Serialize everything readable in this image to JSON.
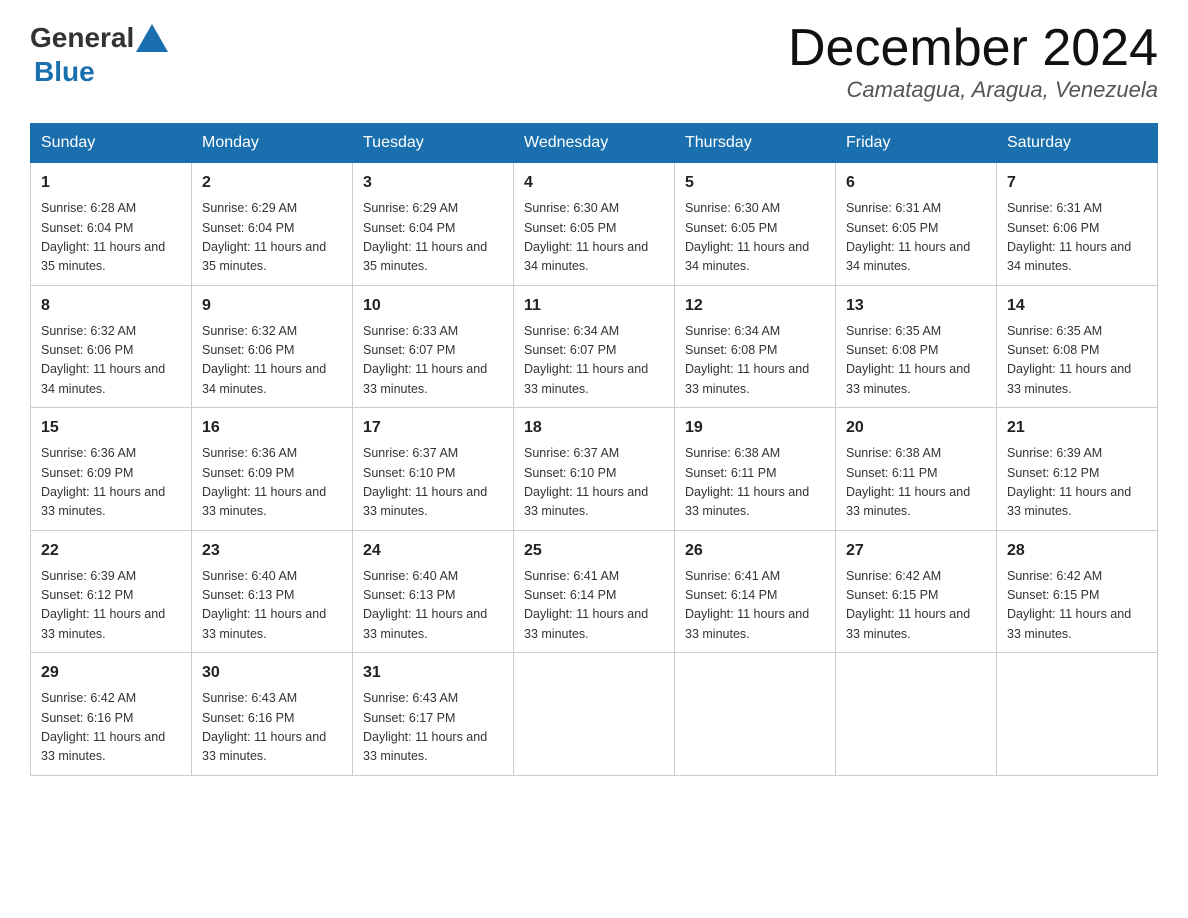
{
  "header": {
    "logo_general": "General",
    "logo_blue": "Blue",
    "month_title": "December 2024",
    "location": "Camatagua, Aragua, Venezuela"
  },
  "days_of_week": [
    "Sunday",
    "Monday",
    "Tuesday",
    "Wednesday",
    "Thursday",
    "Friday",
    "Saturday"
  ],
  "weeks": [
    [
      {
        "day": "1",
        "sunrise": "6:28 AM",
        "sunset": "6:04 PM",
        "daylight": "11 hours and 35 minutes."
      },
      {
        "day": "2",
        "sunrise": "6:29 AM",
        "sunset": "6:04 PM",
        "daylight": "11 hours and 35 minutes."
      },
      {
        "day": "3",
        "sunrise": "6:29 AM",
        "sunset": "6:04 PM",
        "daylight": "11 hours and 35 minutes."
      },
      {
        "day": "4",
        "sunrise": "6:30 AM",
        "sunset": "6:05 PM",
        "daylight": "11 hours and 34 minutes."
      },
      {
        "day": "5",
        "sunrise": "6:30 AM",
        "sunset": "6:05 PM",
        "daylight": "11 hours and 34 minutes."
      },
      {
        "day": "6",
        "sunrise": "6:31 AM",
        "sunset": "6:05 PM",
        "daylight": "11 hours and 34 minutes."
      },
      {
        "day": "7",
        "sunrise": "6:31 AM",
        "sunset": "6:06 PM",
        "daylight": "11 hours and 34 minutes."
      }
    ],
    [
      {
        "day": "8",
        "sunrise": "6:32 AM",
        "sunset": "6:06 PM",
        "daylight": "11 hours and 34 minutes."
      },
      {
        "day": "9",
        "sunrise": "6:32 AM",
        "sunset": "6:06 PM",
        "daylight": "11 hours and 34 minutes."
      },
      {
        "day": "10",
        "sunrise": "6:33 AM",
        "sunset": "6:07 PM",
        "daylight": "11 hours and 33 minutes."
      },
      {
        "day": "11",
        "sunrise": "6:34 AM",
        "sunset": "6:07 PM",
        "daylight": "11 hours and 33 minutes."
      },
      {
        "day": "12",
        "sunrise": "6:34 AM",
        "sunset": "6:08 PM",
        "daylight": "11 hours and 33 minutes."
      },
      {
        "day": "13",
        "sunrise": "6:35 AM",
        "sunset": "6:08 PM",
        "daylight": "11 hours and 33 minutes."
      },
      {
        "day": "14",
        "sunrise": "6:35 AM",
        "sunset": "6:08 PM",
        "daylight": "11 hours and 33 minutes."
      }
    ],
    [
      {
        "day": "15",
        "sunrise": "6:36 AM",
        "sunset": "6:09 PM",
        "daylight": "11 hours and 33 minutes."
      },
      {
        "day": "16",
        "sunrise": "6:36 AM",
        "sunset": "6:09 PM",
        "daylight": "11 hours and 33 minutes."
      },
      {
        "day": "17",
        "sunrise": "6:37 AM",
        "sunset": "6:10 PM",
        "daylight": "11 hours and 33 minutes."
      },
      {
        "day": "18",
        "sunrise": "6:37 AM",
        "sunset": "6:10 PM",
        "daylight": "11 hours and 33 minutes."
      },
      {
        "day": "19",
        "sunrise": "6:38 AM",
        "sunset": "6:11 PM",
        "daylight": "11 hours and 33 minutes."
      },
      {
        "day": "20",
        "sunrise": "6:38 AM",
        "sunset": "6:11 PM",
        "daylight": "11 hours and 33 minutes."
      },
      {
        "day": "21",
        "sunrise": "6:39 AM",
        "sunset": "6:12 PM",
        "daylight": "11 hours and 33 minutes."
      }
    ],
    [
      {
        "day": "22",
        "sunrise": "6:39 AM",
        "sunset": "6:12 PM",
        "daylight": "11 hours and 33 minutes."
      },
      {
        "day": "23",
        "sunrise": "6:40 AM",
        "sunset": "6:13 PM",
        "daylight": "11 hours and 33 minutes."
      },
      {
        "day": "24",
        "sunrise": "6:40 AM",
        "sunset": "6:13 PM",
        "daylight": "11 hours and 33 minutes."
      },
      {
        "day": "25",
        "sunrise": "6:41 AM",
        "sunset": "6:14 PM",
        "daylight": "11 hours and 33 minutes."
      },
      {
        "day": "26",
        "sunrise": "6:41 AM",
        "sunset": "6:14 PM",
        "daylight": "11 hours and 33 minutes."
      },
      {
        "day": "27",
        "sunrise": "6:42 AM",
        "sunset": "6:15 PM",
        "daylight": "11 hours and 33 minutes."
      },
      {
        "day": "28",
        "sunrise": "6:42 AM",
        "sunset": "6:15 PM",
        "daylight": "11 hours and 33 minutes."
      }
    ],
    [
      {
        "day": "29",
        "sunrise": "6:42 AM",
        "sunset": "6:16 PM",
        "daylight": "11 hours and 33 minutes."
      },
      {
        "day": "30",
        "sunrise": "6:43 AM",
        "sunset": "6:16 PM",
        "daylight": "11 hours and 33 minutes."
      },
      {
        "day": "31",
        "sunrise": "6:43 AM",
        "sunset": "6:17 PM",
        "daylight": "11 hours and 33 minutes."
      },
      null,
      null,
      null,
      null
    ]
  ],
  "labels": {
    "sunrise_prefix": "Sunrise: ",
    "sunset_prefix": "Sunset: ",
    "daylight_prefix": "Daylight: "
  }
}
